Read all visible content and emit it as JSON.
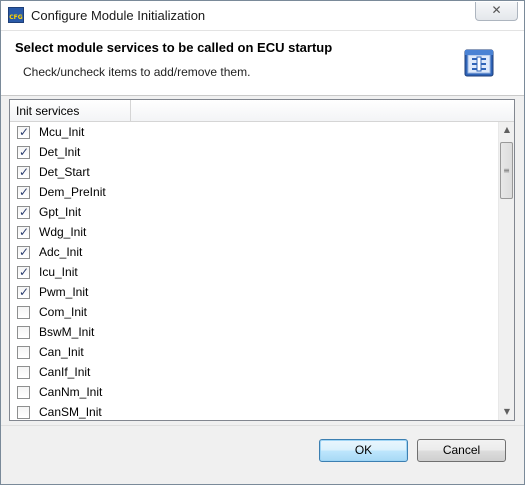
{
  "window": {
    "title": "Configure Module Initialization",
    "app_icon_text": "CFG",
    "close_symbol": "✕"
  },
  "header": {
    "title": "Select module services to be called on ECU startup",
    "subtitle": "Check/uncheck items to add/remove them."
  },
  "table": {
    "column_header": "Init services",
    "rows": [
      {
        "label": "Mcu_Init",
        "checked": true
      },
      {
        "label": "Det_Init",
        "checked": true
      },
      {
        "label": "Det_Start",
        "checked": true
      },
      {
        "label": "Dem_PreInit",
        "checked": true
      },
      {
        "label": "Gpt_Init",
        "checked": true
      },
      {
        "label": "Wdg_Init",
        "checked": true
      },
      {
        "label": "Adc_Init",
        "checked": true
      },
      {
        "label": "Icu_Init",
        "checked": true
      },
      {
        "label": "Pwm_Init",
        "checked": true
      },
      {
        "label": "Com_Init",
        "checked": false
      },
      {
        "label": "BswM_Init",
        "checked": false
      },
      {
        "label": "Can_Init",
        "checked": false
      },
      {
        "label": "CanIf_Init",
        "checked": false
      },
      {
        "label": "CanNm_Init",
        "checked": false
      },
      {
        "label": "CanSM_Init",
        "checked": false
      }
    ]
  },
  "buttons": {
    "ok": "OK",
    "cancel": "Cancel"
  }
}
